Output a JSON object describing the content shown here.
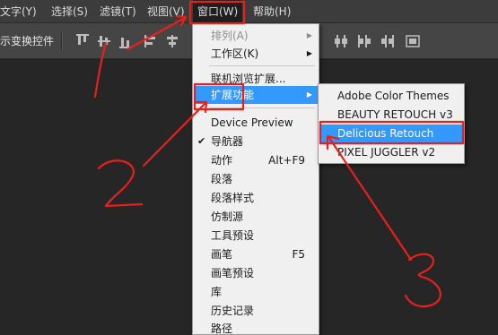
{
  "menubar": {
    "items": [
      {
        "label": "文字(Y)"
      },
      {
        "label": "选择(S)"
      },
      {
        "label": "滤镜(T)"
      },
      {
        "label": "视图(V)"
      },
      {
        "label": "窗口(W)"
      },
      {
        "label": "帮助(H)"
      }
    ]
  },
  "options": {
    "transform_label": "示变换控件"
  },
  "window_menu": {
    "items": [
      {
        "label": "排列(A)",
        "submenu": true,
        "disabled": true
      },
      {
        "label": "工作区(K)",
        "submenu": true
      },
      {
        "label": "联机浏览扩展..."
      },
      {
        "label": "扩展功能",
        "submenu": true,
        "highlighted": true
      },
      {
        "label": "Device Preview"
      },
      {
        "label": "导航器",
        "checked": true,
        "check": "✔"
      },
      {
        "label": "动作",
        "shortcut": "Alt+F9"
      },
      {
        "label": "段落"
      },
      {
        "label": "段落样式"
      },
      {
        "label": "仿制源"
      },
      {
        "label": "工具预设"
      },
      {
        "label": "画笔",
        "shortcut": "F5"
      },
      {
        "label": "画笔预设"
      },
      {
        "label": "库"
      },
      {
        "label": "历史记录"
      },
      {
        "label": "路径"
      }
    ]
  },
  "extensions_submenu": {
    "items": [
      {
        "label": "Adobe Color Themes"
      },
      {
        "label": "BEAUTY RETOUCH v3"
      },
      {
        "label": "Delicious Retouch",
        "highlighted": true
      },
      {
        "label": "PIXEL JUGGLER v2"
      }
    ]
  },
  "annotations": {
    "marks": [
      "1",
      "2",
      "3"
    ],
    "color": "#e8201c"
  },
  "colors": {
    "highlight": "#3399ff",
    "menubar": "#3c3c3c",
    "canvas": "#262626",
    "menu_bg": "#f0f0f0"
  },
  "glyphs": {
    "submenu_arrow": "▶"
  }
}
